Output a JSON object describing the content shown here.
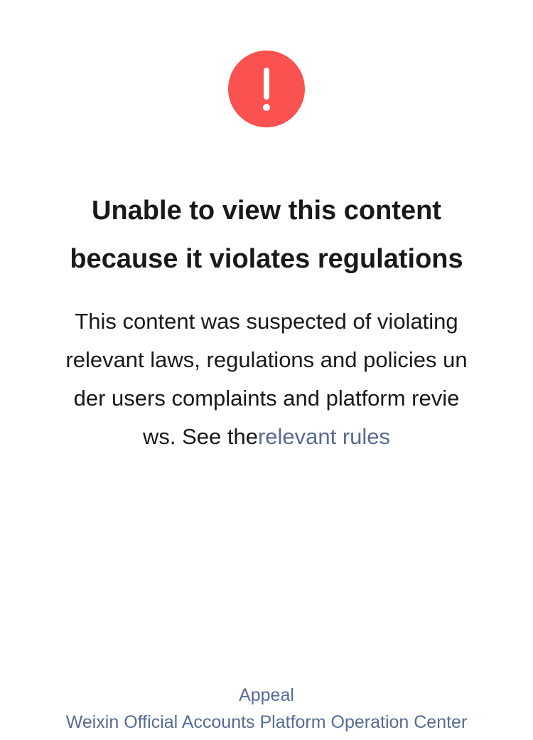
{
  "icon": {
    "name": "warning-exclamation-icon",
    "color": "#FA5151"
  },
  "title_lines": [
    "Unable to view this content",
    "because it violates regulations"
  ],
  "description": {
    "lines": [
      "This content was suspected of violating",
      "relevant laws, regulations and policies un",
      "der users complaints and platform revie"
    ],
    "last_line_prefix": "ws. See the",
    "link_text": "relevant rules"
  },
  "footer": {
    "appeal_label": "Appeal",
    "operator_label": "Weixin Official Accounts Platform Operation Center"
  },
  "colors": {
    "link": "#576B95",
    "text": "#191919",
    "background": "#FFFFFF"
  }
}
